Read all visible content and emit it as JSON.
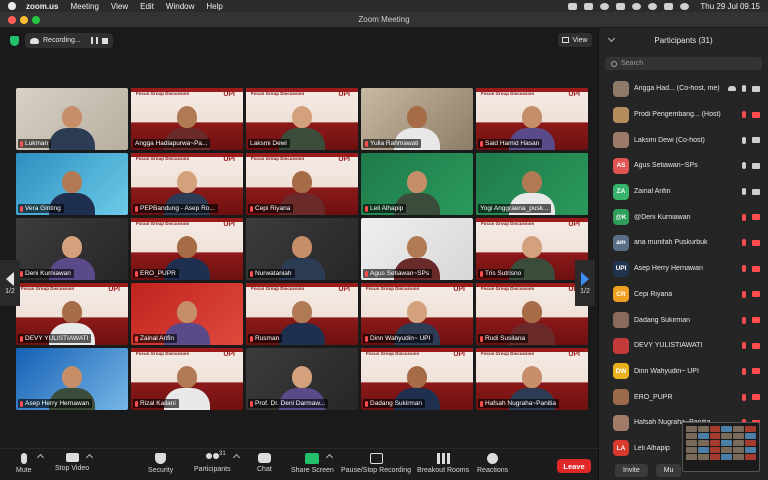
{
  "menubar": {
    "app": "zoom.us",
    "items": [
      "Meeting",
      "View",
      "Edit",
      "Window",
      "Help"
    ],
    "clock": "Thu 29 Jul 09.15"
  },
  "window": {
    "title": "Zoom Meeting"
  },
  "recording": {
    "label": "Recording..."
  },
  "view_button": {
    "label": "View"
  },
  "gallery": {
    "tiles": [
      {
        "name": "Lukman",
        "bg": "home",
        "mic_muted": true
      },
      {
        "name": "Angga Hadiapurwa~Pa...",
        "bg": "banner",
        "mic_muted": false
      },
      {
        "name": "Laksmi Dewi",
        "bg": "banner",
        "mic_muted": false
      },
      {
        "name": "Yulia Rahmawati",
        "bg": "office",
        "mic_muted": true
      },
      {
        "name": "Said Hamid Hasan",
        "bg": "banner",
        "mic_muted": true
      },
      {
        "name": "Vera Ginting",
        "bg": "blue",
        "mic_muted": true
      },
      {
        "name": "PEPBandung - Asep Ro...",
        "bg": "banner",
        "mic_muted": true
      },
      {
        "name": "Cepi Riyana",
        "bg": "banner",
        "mic_muted": true
      },
      {
        "name": "Leli Alhapip",
        "bg": "green",
        "mic_muted": true
      },
      {
        "name": "Yogi Anggraena_pusk...",
        "bg": "green",
        "mic_muted": false,
        "active": true
      },
      {
        "name": "Deni Kurniawan",
        "bg": "dark",
        "mic_muted": true
      },
      {
        "name": "ERO_PUPR",
        "bg": "banner",
        "mic_muted": true
      },
      {
        "name": "Nurwataniah",
        "bg": "dark",
        "mic_muted": true
      },
      {
        "name": "Agus Setiawan~SPs",
        "bg": "white",
        "mic_muted": true
      },
      {
        "name": "Tris Sutrisno",
        "bg": "banner",
        "mic_muted": true
      },
      {
        "name": "DEVY YULISTIAWATI",
        "bg": "banner",
        "mic_muted": true
      },
      {
        "name": "Zainal Arifin",
        "bg": "red",
        "mic_muted": true
      },
      {
        "name": "Rusman",
        "bg": "banner",
        "mic_muted": true
      },
      {
        "name": "Dinn Wahyudin~ UPI",
        "bg": "banner",
        "mic_muted": true
      },
      {
        "name": "Rudi Susilana",
        "bg": "banner",
        "mic_muted": true
      },
      {
        "name": "Asep Herry Hernawan",
        "bg": "photo",
        "mic_muted": true
      },
      {
        "name": "Rizal Kailani",
        "bg": "banner",
        "mic_muted": true
      },
      {
        "name": "Prof. Dr. Deni Darmaw...",
        "bg": "dark",
        "mic_muted": true
      },
      {
        "name": "Dadang Sukirman",
        "bg": "banner",
        "mic_muted": true
      },
      {
        "name": "Hafsah Nugraha~Panitia",
        "bg": "banner",
        "mic_muted": true
      }
    ],
    "banner_text": "Focus Group Discussion",
    "banner_logo": "UPI",
    "page_left": "1/2",
    "page_right": "1/2"
  },
  "participants_panel": {
    "title": "Participants (31)",
    "search_placeholder": "Search",
    "people": [
      {
        "name": "Angga Had... (Co-host, me)",
        "initials": "",
        "avatar_color": "#8d7a68",
        "cloud": true,
        "mic_muted": false,
        "cam_off": false
      },
      {
        "name": "Prodi Pengembang... (Host)",
        "initials": "",
        "avatar_color": "#b58c5c",
        "cloud": false,
        "mic_muted": true,
        "cam_off": true
      },
      {
        "name": "Laksmi Dewi (Co-host)",
        "initials": "",
        "avatar_color": "#9c7b6a",
        "cloud": false,
        "mic_muted": false,
        "cam_off": false
      },
      {
        "name": "Agus Setiawan~SPs",
        "initials": "AS",
        "avatar_color": "#e05454",
        "cloud": false,
        "mic_muted": false,
        "cam_off": false
      },
      {
        "name": "Zainal Arifin",
        "initials": "ZA",
        "avatar_color": "#37b36b",
        "cloud": false,
        "mic_muted": false,
        "cam_off": false
      },
      {
        "name": "@Deni Kurniawan",
        "initials": "@K",
        "avatar_color": "#2f9e58",
        "cloud": false,
        "mic_muted": true,
        "cam_off": true
      },
      {
        "name": "ana munifah Puskurbuk",
        "initials": "am",
        "avatar_color": "#5a6f86",
        "cloud": false,
        "mic_muted": true,
        "cam_off": true
      },
      {
        "name": "Asep Herry Hernawan",
        "initials": "UPI",
        "avatar_color": "#22334f",
        "cloud": false,
        "mic_muted": true,
        "cam_off": true
      },
      {
        "name": "Cepi Riyana",
        "initials": "CR",
        "avatar_color": "#f0a020",
        "cloud": false,
        "mic_muted": true,
        "cam_off": true
      },
      {
        "name": "Dadang Sukirman",
        "initials": "",
        "avatar_color": "#8a6a5a",
        "cloud": false,
        "mic_muted": true,
        "cam_off": true
      },
      {
        "name": "DEVY YULISTIAWATI",
        "initials": "",
        "avatar_color": "#c23a3a",
        "cloud": false,
        "mic_muted": true,
        "cam_off": true
      },
      {
        "name": "Dinn Wahyudin~ UPI",
        "initials": "DW",
        "avatar_color": "#e9b020",
        "cloud": false,
        "mic_muted": true,
        "cam_off": true
      },
      {
        "name": "ERO_PUPR",
        "initials": "",
        "avatar_color": "#9a6a4a",
        "cloud": false,
        "mic_muted": true,
        "cam_off": true
      },
      {
        "name": "Hafsah Nugraha~Panitia",
        "initials": "",
        "avatar_color": "#a27a68",
        "cloud": false,
        "mic_muted": true,
        "cam_off": true
      },
      {
        "name": "Leli Alhapip",
        "initials": "LA",
        "avatar_color": "#d83a2e",
        "cloud": false,
        "mic_muted": true,
        "cam_off": true
      }
    ],
    "invite_label": "Invite",
    "mute_label": "Mu"
  },
  "toolbar": {
    "mute": "Mute",
    "stop_video": "Stop Video",
    "security": "Security",
    "participants": "Participants",
    "participants_count": "31",
    "chat": "Chat",
    "share_screen": "Share Screen",
    "pause_stop_recording": "Pause/Stop Recording",
    "breakout_rooms": "Breakout Rooms",
    "reactions": "Reactions",
    "leave": "Leave"
  },
  "colors": {
    "accent_green": "#23c06b",
    "leave_red": "#e02828",
    "active_speaker": "#d9dd6a"
  }
}
